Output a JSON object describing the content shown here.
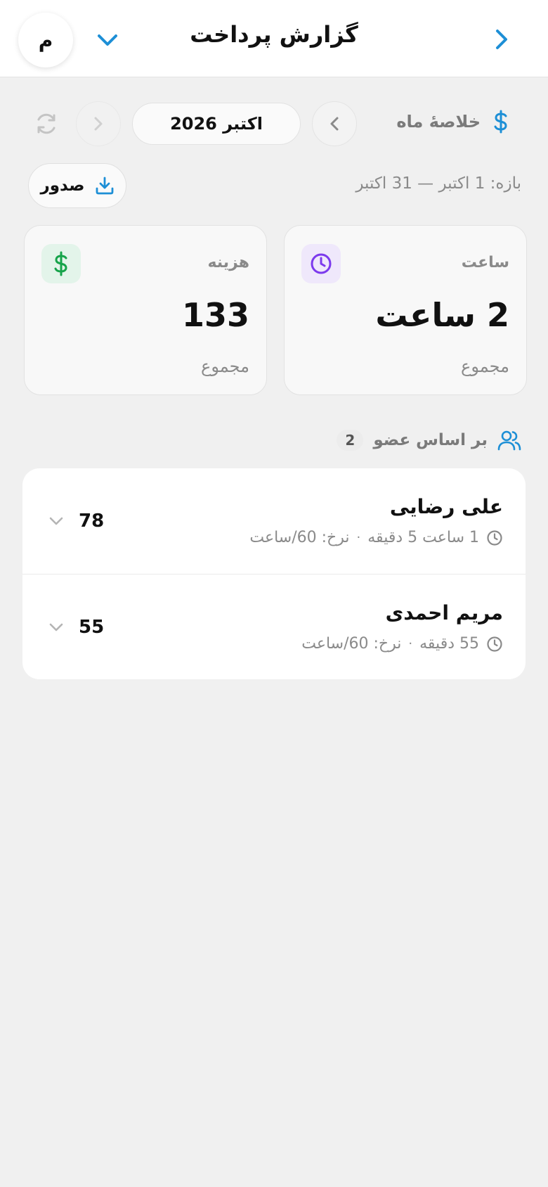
{
  "header": {
    "title": "گزارش پرداخت",
    "avatar_initial": "م"
  },
  "month": {
    "section_label": "خلاصهٔ ماه",
    "current": "اکتبر 2026"
  },
  "range": {
    "text": "بازه: 1 اکتبر — 31 اکتبر",
    "export_label": "صدور"
  },
  "stats": {
    "hours": {
      "label": "ساعت",
      "value": "2 ساعت",
      "sub": "مجموع",
      "icon": "clock-icon",
      "color": "#7c3aed"
    },
    "cost": {
      "label": "هزینه",
      "value": "133",
      "sub": "مجموع",
      "icon": "dollar-icon",
      "color": "#16a34a"
    }
  },
  "members": {
    "title": "بر اساس عضو",
    "count": "2",
    "items": [
      {
        "name": "علی رضایی",
        "duration": "1 ساعت 5 دقیقه",
        "rate": "نرخ: 60/ساعت",
        "amount": "78"
      },
      {
        "name": "مریم احمدی",
        "duration": "55 دقیقه",
        "rate": "نرخ: 60/ساعت",
        "amount": "55"
      }
    ]
  },
  "colors": {
    "accent": "#1d8fd6",
    "muted": "#8a8a8a",
    "background": "#f0f0f0"
  }
}
